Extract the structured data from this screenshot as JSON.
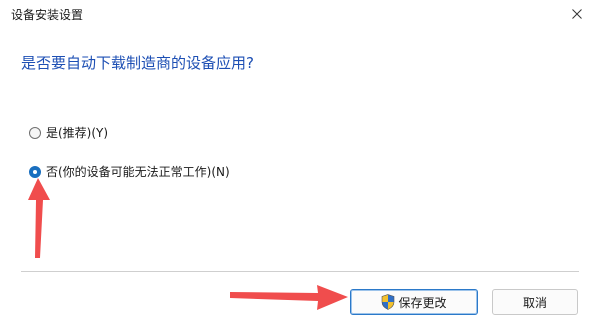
{
  "window": {
    "title": "设备安装设置"
  },
  "question": "是否要自动下载制造商的设备应用?",
  "options": [
    {
      "label": "是(推荐)(Y)",
      "selected": false
    },
    {
      "label": "否(你的设备可能无法正常工作)(N)",
      "selected": true
    }
  ],
  "buttons": {
    "save_label": "保存更改",
    "cancel_label": "取消"
  },
  "icons": {
    "close": "close-icon",
    "save": "uac-shield-icon",
    "annotations": "red-arrow-icon"
  },
  "colors": {
    "question_text": "#1d4fb4",
    "radio_selected": "#1a6fbf",
    "annotation_arrow": "#f04d4d"
  }
}
